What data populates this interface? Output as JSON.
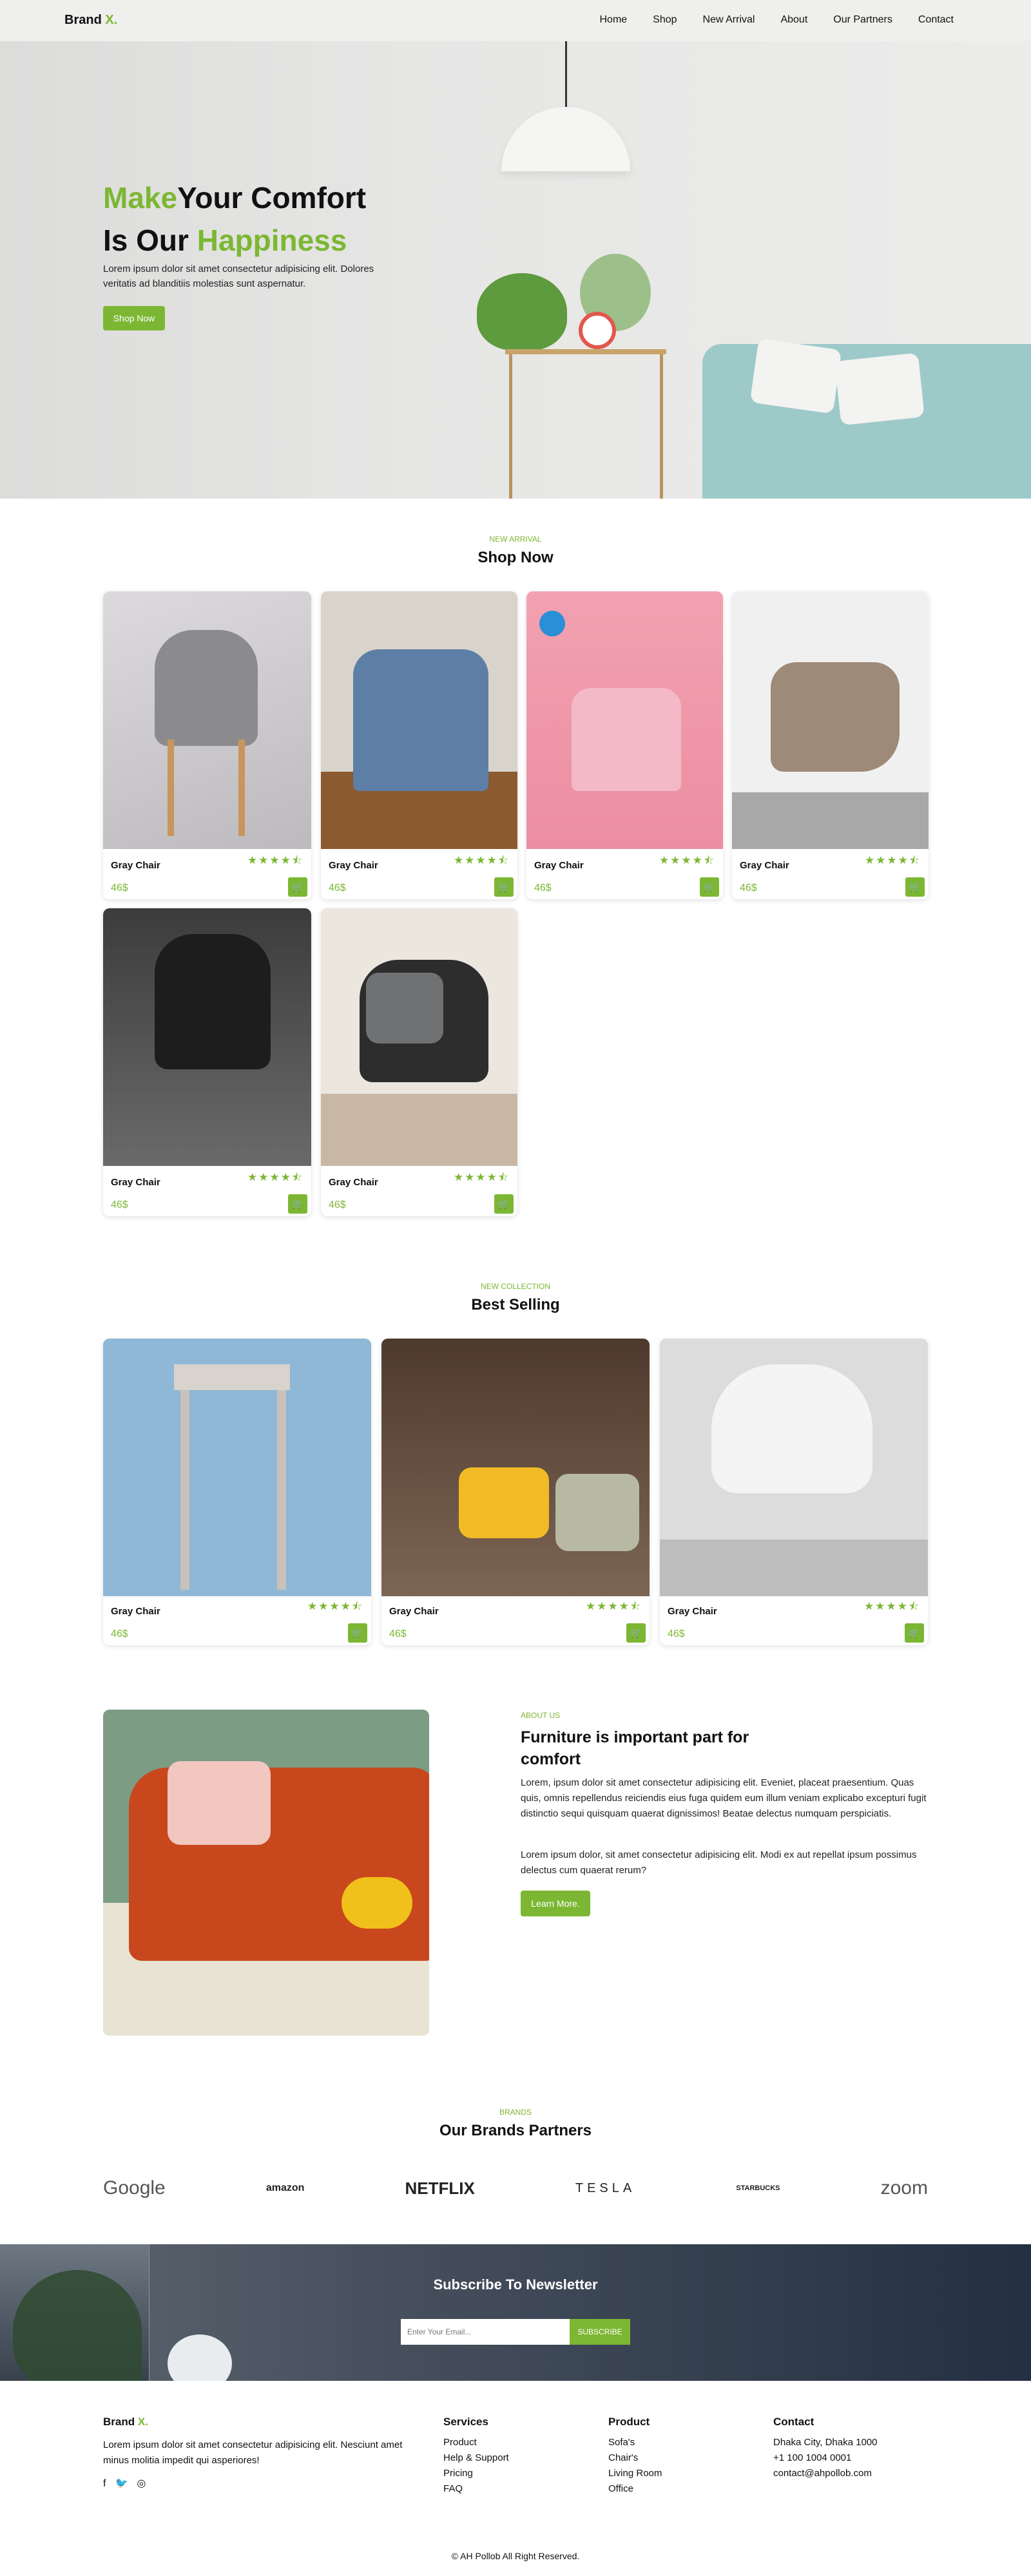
{
  "nav": {
    "brand": "Brand",
    "brand_x": "X.",
    "links": [
      "Home",
      "Shop",
      "New Arrival",
      "About",
      "Our Partners",
      "Contact"
    ]
  },
  "hero": {
    "line1_green": "Make",
    "line1_rest": "Your Comfort",
    "line2_rest": "Is Our",
    "line2_green": "Happiness",
    "text": "Lorem ipsum dolor sit amet consectetur adipisicing elit. Dolores veritatis ad blanditiis molestias sunt aspernatur.",
    "button": "Shop Now"
  },
  "shop": {
    "label": "NEW ARRIVAL",
    "title": "Shop Now",
    "products": [
      {
        "name": "Gray Chair",
        "price": "46$",
        "stars": "★★★★⯪"
      },
      {
        "name": "Gray Chair",
        "price": "46$",
        "stars": "★★★★⯪"
      },
      {
        "name": "Gray Chair",
        "price": "46$",
        "stars": "★★★★⯪"
      },
      {
        "name": "Gray Chair",
        "price": "46$",
        "stars": "★★★★⯪"
      },
      {
        "name": "Gray Chair",
        "price": "46$",
        "stars": "★★★★⯪"
      },
      {
        "name": "Gray Chair",
        "price": "46$",
        "stars": "★★★★⯪"
      }
    ]
  },
  "best": {
    "label": "NEW COLLECTION",
    "title": "Best Selling",
    "products": [
      {
        "name": "Gray Chair",
        "price": "46$",
        "stars": "★★★★⯪"
      },
      {
        "name": "Gray Chair",
        "price": "46$",
        "stars": "★★★★⯪"
      },
      {
        "name": "Gray Chair",
        "price": "46$",
        "stars": "★★★★⯪"
      }
    ]
  },
  "about": {
    "label": "ABOUT US",
    "title": "Furniture is important part for comfort",
    "p1": "Lorem, ipsum dolor sit amet consectetur adipisicing elit. Eveniet, placeat praesentium. Quas quis, omnis repellendus reiciendis eius fuga quidem eum illum veniam explicabo excepturi fugit distinctio sequi quisquam quaerat dignissimos! Beatae delectus numquam perspiciatis.",
    "p2": "Lorem ipsum dolor, sit amet consectetur adipisicing elit. Modi ex aut repellat ipsum possimus delectus cum quaerat rerum?",
    "button": "Learn More."
  },
  "brands": {
    "label": "BRANDS",
    "title": "Our Brands Partners",
    "logos": [
      "Google",
      "amazon",
      "NETFLIX",
      "TESLA",
      "STARBUCKS",
      "zoom"
    ]
  },
  "newsletter": {
    "title": "Subscribe To Newsletter",
    "placeholder": "Enter Your Email...",
    "button": "SUBSCRIBE"
  },
  "footer": {
    "brand": "Brand",
    "brand_x": "X.",
    "about": "Lorem ipsum dolor sit amet consectetur adipisicing elit. Nesciunt amet minus molitia impedit qui asperiores!",
    "services_title": "Services",
    "services": [
      "Product",
      "Help & Support",
      "Pricing",
      "FAQ"
    ],
    "product_title": "Product",
    "products": [
      "Sofa's",
      "Chair's",
      "Living Room",
      "Office"
    ],
    "contact_title": "Contact",
    "contact": [
      "Dhaka City, Dhaka 1000",
      "+1 100 1004 0001",
      "contact@ahpollob.com"
    ],
    "copyright": "© AH Pollob All Right Reserved."
  },
  "colors": {
    "accent": "#7cb733",
    "dark": "#111111"
  }
}
